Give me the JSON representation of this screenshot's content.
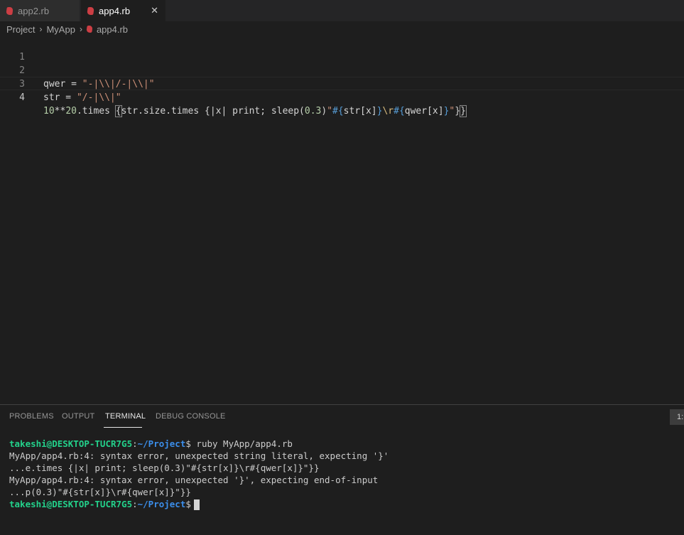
{
  "tabs": [
    {
      "label": "app2.rb",
      "icon": "ruby-file-icon",
      "active": false
    },
    {
      "label": "app4.rb",
      "icon": "ruby-file-icon",
      "active": true,
      "close": "✕"
    }
  ],
  "breadcrumb": [
    "Project",
    "MyApp",
    "app4.rb"
  ],
  "editor": {
    "line_numbers": [
      "1",
      "2",
      "3",
      "4"
    ],
    "line2": {
      "var": "qwer",
      "op": " = ",
      "str": "\"-|\\\\|/-|\\\\|\""
    },
    "line3": {
      "var": "str",
      "op": " = ",
      "str": "\"/-|\\\\|\""
    },
    "line4": {
      "n1": "10",
      "op1": "**",
      "n2": "20",
      "t1": ".times ",
      "b1": "{",
      "t2": "str.size.times {|x| print; sleep(",
      "n3": "0.3",
      "t3": ")",
      "q1": "\"",
      "i1": "#{",
      "t4": "str[x]",
      "i2": "}",
      "esc": "\\r",
      "i3": "#{",
      "t5": "qwer[x]",
      "i4": "}",
      "q2": "\"",
      "t6": "}",
      "b2": "}"
    }
  },
  "panel": {
    "tabs": [
      "PROBLEMS",
      "OUTPUT",
      "TERMINAL",
      "DEBUG CONSOLE"
    ],
    "active_tab": "TERMINAL",
    "dropdown": "1:",
    "terminal": {
      "prompt_user": "takeshi@DESKTOP-TUCR7G5",
      "prompt_colon": ":",
      "prompt_path": "~/Project",
      "prompt_dollar": "$",
      "command": " ruby MyApp/app4.rb",
      "output": [
        "MyApp/app4.rb:4: syntax error, unexpected string literal, expecting '}'",
        "...e.times {|x| print; sleep(0.3)\"#{str[x]}\\r#{qwer[x]}\"}}",
        "MyApp/app4.rb:4: syntax error, unexpected '}', expecting end-of-input",
        "...p(0.3)\"#{str[x]}\\r#{qwer[x]}\"}}"
      ]
    }
  }
}
